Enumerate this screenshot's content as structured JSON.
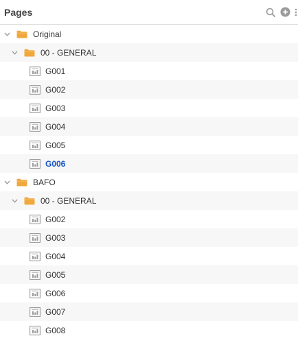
{
  "panel": {
    "title": "Pages",
    "icons": {
      "search": "search-icon",
      "add": "add-circle-icon",
      "more": "more-vertical-icon"
    }
  },
  "colors": {
    "folder": "#f0a83c",
    "active": "#1a56c4",
    "icon": "#9a9a9a",
    "alt_row": "#f7f7f7"
  },
  "tree": {
    "groups": [
      {
        "label": "Original",
        "expanded": true,
        "folders": [
          {
            "label": "00 - GENERAL",
            "expanded": true,
            "pages": [
              {
                "label": "G001",
                "active": false
              },
              {
                "label": "G002",
                "active": false
              },
              {
                "label": "G003",
                "active": false
              },
              {
                "label": "G004",
                "active": false
              },
              {
                "label": "G005",
                "active": false
              },
              {
                "label": "G006",
                "active": true
              }
            ]
          }
        ]
      },
      {
        "label": "BAFO",
        "expanded": true,
        "folders": [
          {
            "label": "00 - GENERAL",
            "expanded": true,
            "pages": [
              {
                "label": "G002",
                "active": false
              },
              {
                "label": "G003",
                "active": false
              },
              {
                "label": "G004",
                "active": false
              },
              {
                "label": "G005",
                "active": false
              },
              {
                "label": "G006",
                "active": false
              },
              {
                "label": "G007",
                "active": false
              },
              {
                "label": "G008",
                "active": false
              }
            ]
          }
        ]
      }
    ]
  }
}
